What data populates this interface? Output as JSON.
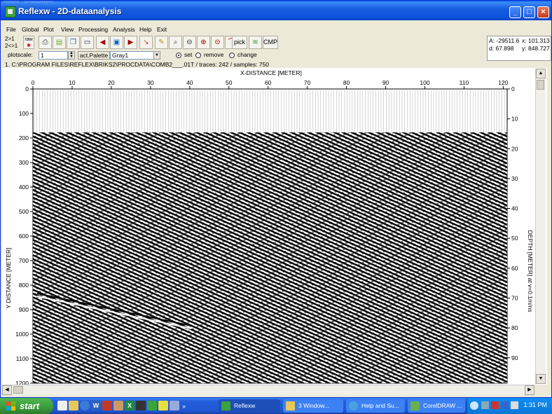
{
  "window": {
    "title": "Reflexw - 2D-dataanalysis",
    "ghost_title": "ReflexW - 2D-dataanalysis"
  },
  "titlebar_buttons": {
    "minimize": "_",
    "maximize": "□",
    "close": "×"
  },
  "menu": [
    "File",
    "Global",
    "Plot",
    "View",
    "Processing",
    "Analysis",
    "Help",
    "Exit"
  ],
  "toolbar": {
    "top_left_top": "2>1",
    "top_left_bottom": "2<>1",
    "raw_label": "raw",
    "pick_label": "pick",
    "cmp_label": "CMP"
  },
  "status": {
    "a_label": "A:",
    "a_value": "-29511.6",
    "x_label": "x:",
    "x_value": "101.313",
    "d_label": "d:",
    "d_value": "67.898",
    "y_label": "y:",
    "y_value": "848.727"
  },
  "options": {
    "plotscale_label": "plotscale:",
    "plotscale_value": "1",
    "palette_button": "act.Palette",
    "palette_value": "Gray1",
    "radio_set": "set",
    "radio_remove": "remove",
    "radio_change": "change"
  },
  "file_info": "1. C:\\PROGRAM FILES\\REFLEX\\BRIKS2\\PROCDATA\\COMB2___.01T / traces: 242 / samples: 750",
  "plot": {
    "x_title": "X-DISTANCE [METER]",
    "y_title": "Y DISTANCE [METER]",
    "right_title": "DEPTH [METER] at v=0.1m/ns",
    "x_ticks": [
      "0",
      "10",
      "20",
      "30",
      "40",
      "50",
      "60",
      "70",
      "80",
      "90",
      "100",
      "110",
      "120"
    ],
    "y_ticks": [
      "0",
      "100",
      "200",
      "300",
      "400",
      "500",
      "600",
      "700",
      "800",
      "900",
      "1000",
      "1100",
      "1200"
    ],
    "right_ticks": [
      "0",
      "10",
      "20",
      "30",
      "40",
      "50",
      "60",
      "70",
      "80",
      "90"
    ]
  },
  "taskbar": {
    "start": "start",
    "tasks": [
      {
        "label": "Reflexw"
      },
      {
        "label": "3 Window..."
      },
      {
        "label": "Help and Su..."
      },
      {
        "label": "CorelDRAW ..."
      }
    ],
    "clock": "1:31 PM"
  },
  "colors": {
    "title_blue": "#0a5ce8",
    "start_green": "#3c9a3c",
    "taskbar_blue": "#245edb"
  }
}
